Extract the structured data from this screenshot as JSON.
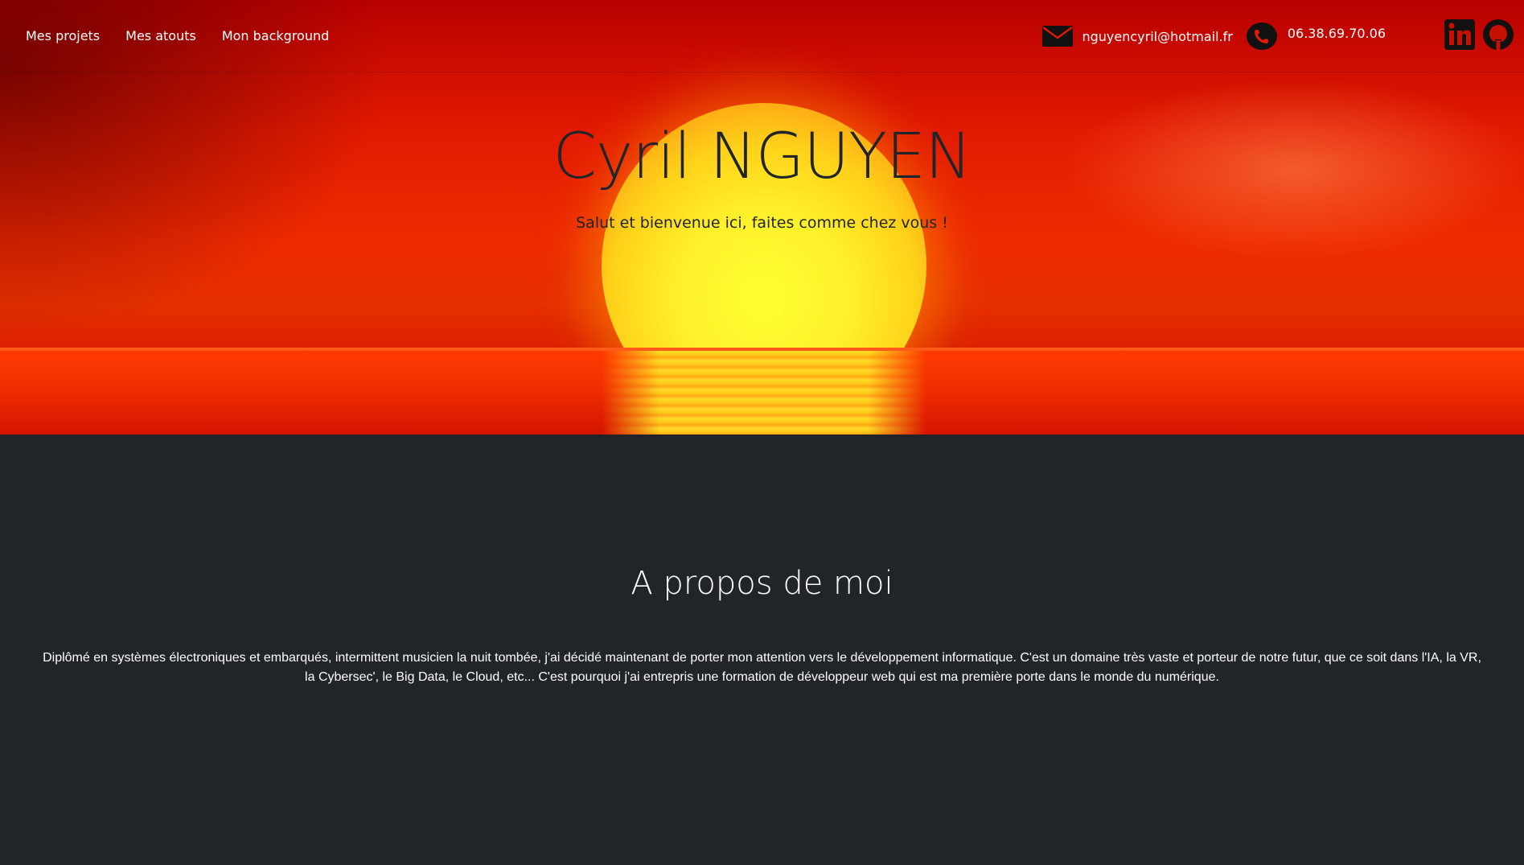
{
  "nav": {
    "links": [
      {
        "label": "Mes projets"
      },
      {
        "label": "Mes atouts"
      },
      {
        "label": "Mon background"
      }
    ]
  },
  "contact": {
    "email": "nguyencyril@hotmail.fr",
    "phone": "06.38.69.70.06",
    "icons": [
      "mail-icon",
      "phone-icon",
      "linkedin-icon",
      "github-icon"
    ]
  },
  "hero": {
    "title": "Cyril NGUYEN",
    "subtitle": "Salut et bienvenue ici, faites comme chez vous !"
  },
  "about": {
    "title": "A propos de moi",
    "text": "Diplômé en systèmes électroniques et embarqués, intermittent musicien la nuit tombée, j'ai décidé maintenant de porter mon attention vers le développement informatique. C'est un domaine très vaste et porteur de notre futur, que ce soit dans l'IA, la VR, la Cybersec', le Big Data, le Cloud, etc... C'est pourquoi j'ai entrepris une formation de développeur web qui est ma première porte dans le monde du numérique."
  },
  "colors": {
    "dark_bg": "#212529",
    "hero_red": "#e21a00",
    "sun_yellow": "#fff02a",
    "text_light": "#ffffff",
    "text_dark": "#212529"
  }
}
